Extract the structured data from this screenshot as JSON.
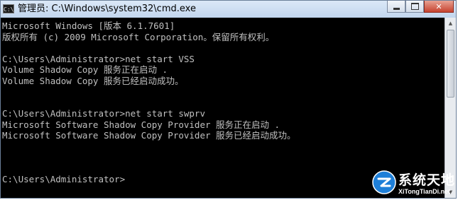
{
  "window": {
    "title": "管理员: C:\\Windows\\system32\\cmd.exe",
    "icon_label": "C:\\",
    "close_label": "✕"
  },
  "console": {
    "lines": [
      "Microsoft Windows [版本 6.1.7601]",
      "版权所有 (c) 2009 Microsoft Corporation。保留所有权利。",
      "",
      "C:\\Users\\Administrator>net start VSS",
      "Volume Shadow Copy 服务正在启动 .",
      "Volume Shadow Copy 服务已经启动成功。",
      "",
      "",
      "C:\\Users\\Administrator>net start swprv",
      "Microsoft Software Shadow Copy Provider 服务正在启动 .",
      "Microsoft Software Shadow Copy Provider 服务已经启动成功。",
      "",
      "",
      "",
      "C:\\Users\\Administrator>"
    ]
  },
  "scrollbar": {
    "up_arrow": "▲",
    "down_arrow": "▼",
    "position_fraction": 0.0
  },
  "watermark": {
    "title": "系统天地",
    "url": "XiTongTianDi.net",
    "brand_color": "#1e7fd8"
  }
}
